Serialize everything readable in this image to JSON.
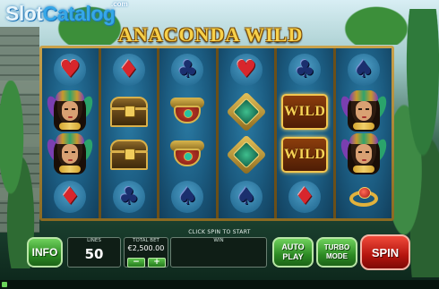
{
  "watermark": {
    "part1": "Slot",
    "part2": "Catalog",
    "domain": ".com"
  },
  "game": {
    "title": "ANACONDA WILD"
  },
  "reels": [
    [
      "heart-red",
      "queen",
      "queen",
      "diamond-red"
    ],
    [
      "diamond-red",
      "chest",
      "chest",
      "club-navy"
    ],
    [
      "club-navy",
      "mask",
      "mask",
      "spade-navy"
    ],
    [
      "heart-red",
      "medallion",
      "medallion",
      "spade-navy"
    ],
    [
      "club-navy",
      "wild",
      "wild",
      "diamond-red"
    ],
    [
      "spade-navy",
      "queen",
      "queen",
      "ring"
    ]
  ],
  "symbols": {
    "wild_label": "WILD"
  },
  "panel": {
    "hint": "CLICK SPIN TO START",
    "info_label": "INFO",
    "lines_label": "LINES",
    "lines_value": "50",
    "total_bet_label": "TOTAL BET",
    "total_bet_value": "€2,500.00",
    "minus_label": "−",
    "plus_label": "+",
    "win_label": "WIN",
    "auto_line1": "AUTO",
    "auto_line2": "PLAY",
    "turbo_line1": "TURBO",
    "turbo_line2": "MODE",
    "spin_label": "SPIN"
  },
  "colors": {
    "accent_green": "#2c8a23",
    "spin_red": "#b4150f",
    "reel_blue": "#1b5b80",
    "gold": "#d9b04a"
  }
}
